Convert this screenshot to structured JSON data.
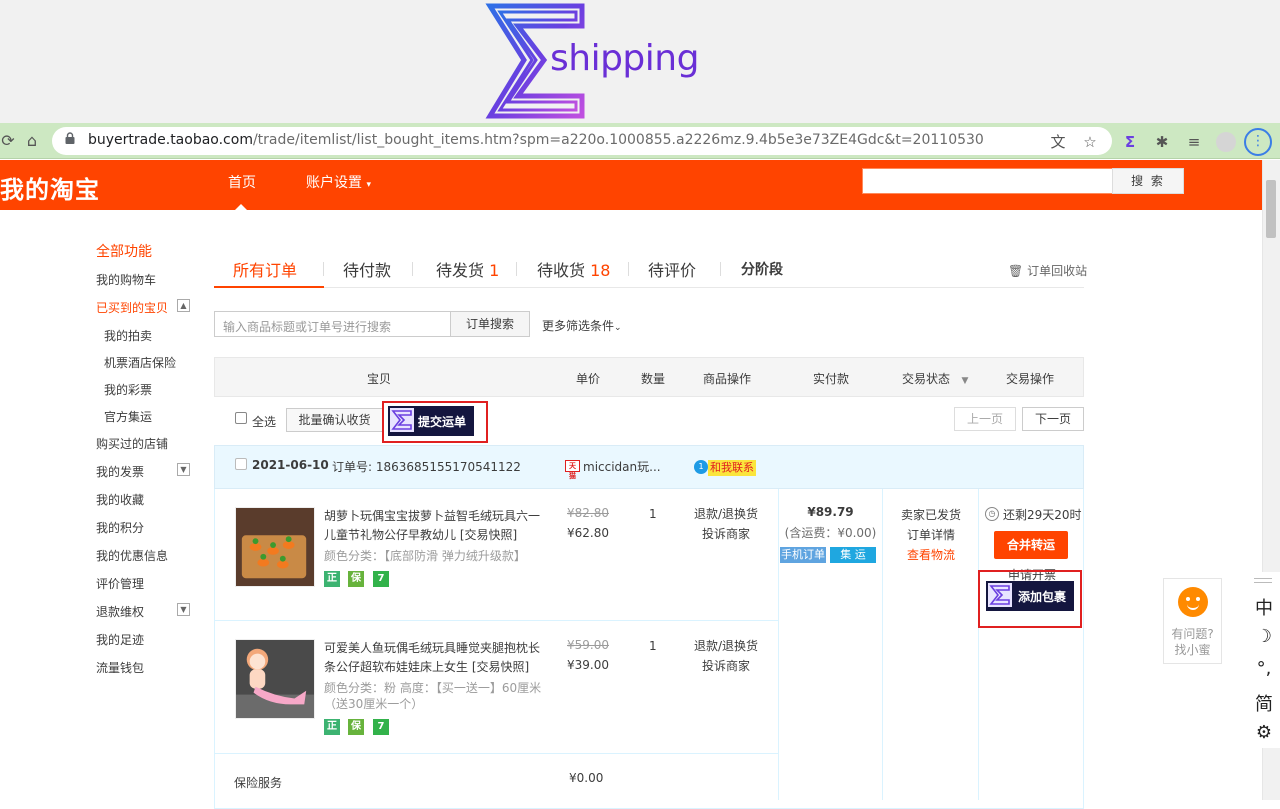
{
  "logo": {
    "text": "shipping"
  },
  "browser": {
    "url_host": "buyertrade.taobao.com",
    "url_path": "/trade/itemlist/list_bought_items.htm?spm=a220o.1000855.a2226mz.9.4b5e3e73ZE4Gdc&t=20110530"
  },
  "header": {
    "title": "我的淘宝",
    "nav_home": "首页",
    "nav_account": "账户设置",
    "search_button": "搜 索"
  },
  "sidebar": {
    "items": [
      "全部功能",
      "我的购物车",
      "已买到的宝贝",
      "我的拍卖",
      "机票酒店保险",
      "我的彩票",
      "官方集运",
      "购买过的店铺",
      "我的发票",
      "我的收藏",
      "我的积分",
      "我的优惠信息",
      "评价管理",
      "退款维权",
      "我的足迹",
      "流量钱包"
    ]
  },
  "tabs": {
    "all": "所有订单",
    "pending_pay": "待付款",
    "pending_ship": "待发货",
    "pending_ship_count": "1",
    "pending_receive": "待收货",
    "pending_receive_count": "18",
    "pending_review": "待评价",
    "installment": "分阶段",
    "recycle": "订单回收站"
  },
  "search": {
    "placeholder": "输入商品标题或订单号进行搜索",
    "button": "订单搜索",
    "more_filters": "更多筛选条件"
  },
  "table_header": {
    "item": "宝贝",
    "unit_price": "单价",
    "qty": "数量",
    "item_ops": "商品操作",
    "paid": "实付款",
    "status": "交易状态",
    "trade_ops": "交易操作"
  },
  "bulk": {
    "select_all": "全选",
    "confirm_receipt": "批量确认收货",
    "submit_waybill": "提交运单",
    "prev": "上一页",
    "next": "下一页"
  },
  "order": {
    "date": "2021-06-10",
    "order_no_label": "订单号:",
    "order_no": "1863685155170541122",
    "tmall": "天猫",
    "shop": "miccidan玩...",
    "contact_num": "1",
    "contact": "和我联系",
    "items": [
      {
        "name": "胡萝卜玩偶宝宝拔萝卜益智毛绒玩具六一儿童节礼物公仔早教幼儿 [交易快照]",
        "attr": "颜色分类：【底部防滑 弹力绒升级款】",
        "orig_price": "¥82.80",
        "price": "¥62.80",
        "qty": "1",
        "op1": "退款/退换货",
        "op2": "投诉商家"
      },
      {
        "name": "可爱美人鱼玩偶毛绒玩具睡觉夹腿抱枕长条公仔超软布娃娃床上女生 [交易快照]",
        "attr": "颜色分类：粉  高度：【买一送一】60厘米（送30厘米一个）",
        "orig_price": "¥59.00",
        "price": "¥39.00",
        "qty": "1",
        "op1": "退款/退换货",
        "op2": "投诉商家"
      }
    ],
    "badges": [
      "正",
      "保",
      "7"
    ],
    "total": "¥89.79",
    "shipping_inc": "(含运费：¥0.00)",
    "tag_phone": "手机订单",
    "tag_ji": "集 运",
    "status": "卖家已发货",
    "order_detail": "订单详情",
    "logistics": "查看物流",
    "remain": "还剩29天20时",
    "merge": "合并转运",
    "invoice": "申请开票",
    "add_package": "添加包裹",
    "insurance": "保险服务",
    "insurance_price": "¥0.00"
  },
  "help": {
    "line1": "有问题?",
    "line2": "找小蜜"
  },
  "ime": {
    "items": [
      "中",
      "☽",
      "°,",
      "简",
      "⚙"
    ]
  },
  "colors": {
    "brand_orange": "#ff4400",
    "ext_navy": "#14163f",
    "highlight_red": "#e02020"
  }
}
